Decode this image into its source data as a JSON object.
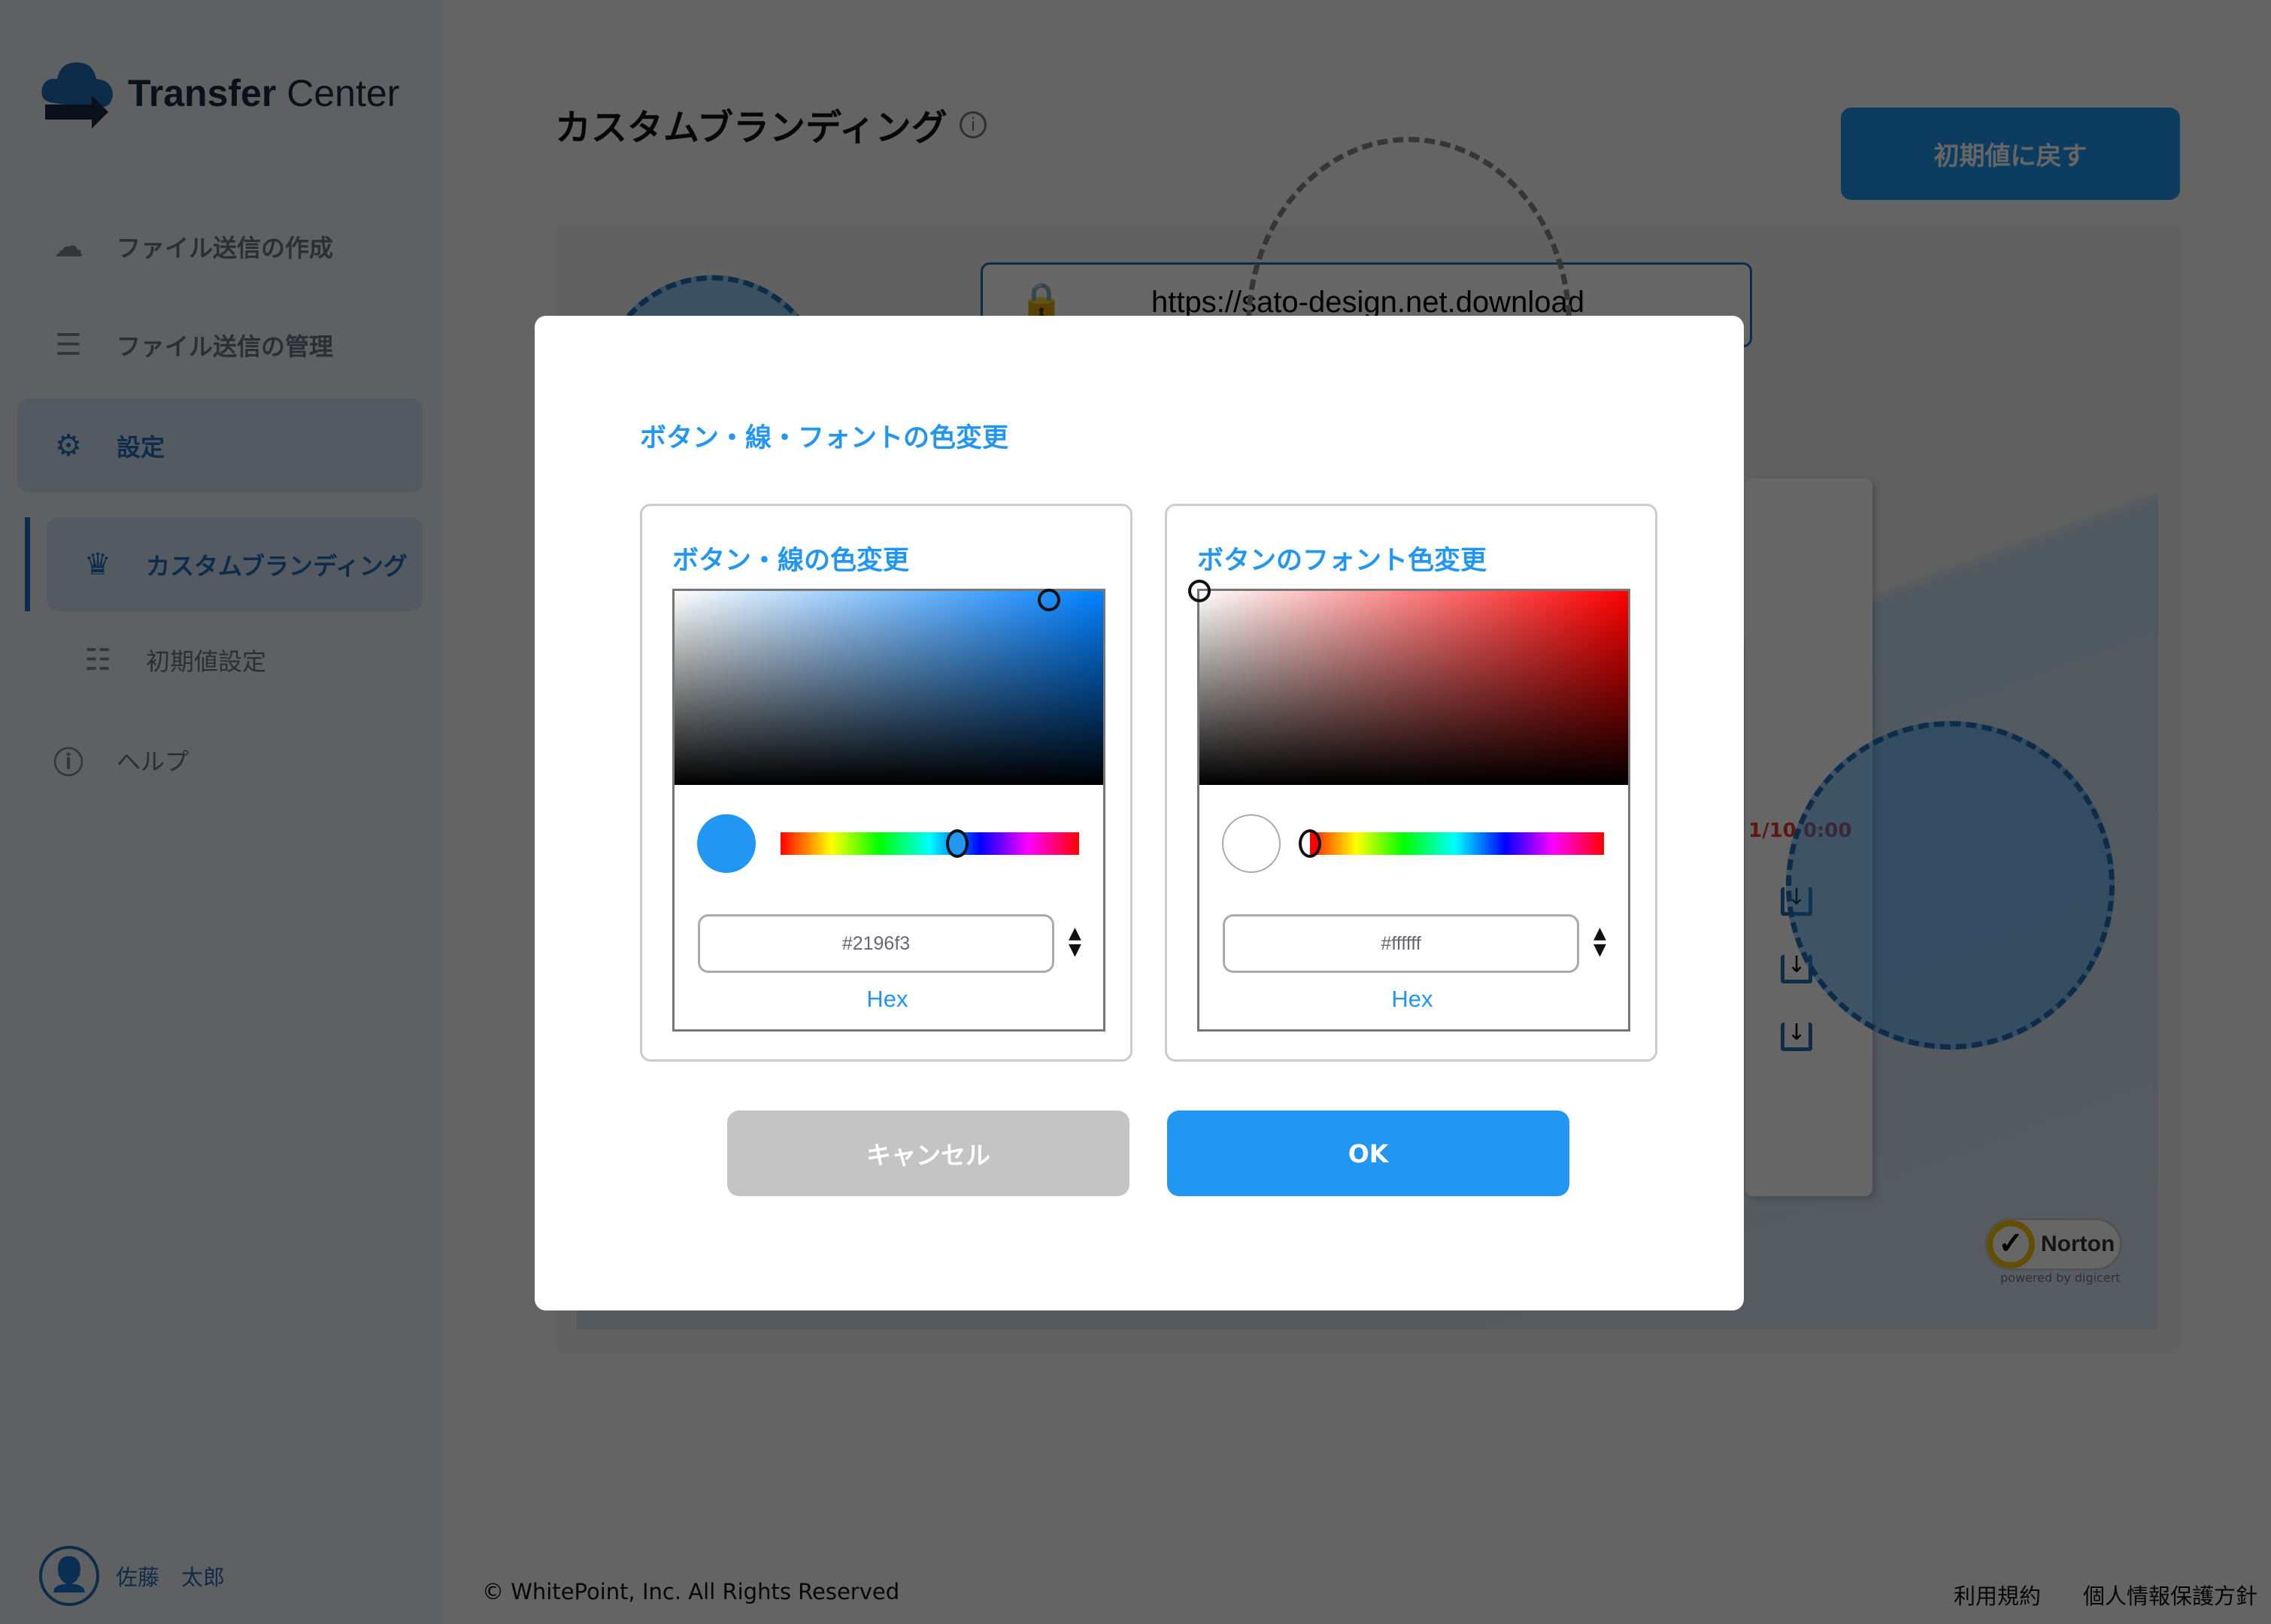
{
  "app": {
    "logo_text_bold": "Transfer",
    "logo_text_light": " Center"
  },
  "sidebar": {
    "items": [
      {
        "label": "ファイル送信の作成",
        "icon": "cloud-upload-icon"
      },
      {
        "label": "ファイル送信の管理",
        "icon": "list-icon"
      },
      {
        "label": "設定",
        "icon": "gear-icon",
        "active": true
      },
      {
        "label": "カスタムブランディング",
        "icon": "crown-icon",
        "active": true
      },
      {
        "label": "初期値設定",
        "icon": "sliders-icon"
      },
      {
        "label": "ヘルプ",
        "icon": "help-icon"
      }
    ],
    "user": "佐藤　太郎"
  },
  "page": {
    "title": "カスタムブランディング",
    "reset_label": "初期値に戻す"
  },
  "preview": {
    "url": "https://sato-design.net.download",
    "date": "1/10 0:00",
    "norton": "Norton",
    "norton_sub": "powered by digicert"
  },
  "footer": {
    "copyright": "© WhitePoint, Inc. All Rights Reserved",
    "terms": "利用規約",
    "privacy": "個人情報保護方針"
  },
  "modal": {
    "heading": "ボタン・線・フォントの色変更",
    "pickers": [
      {
        "title": "ボタン・線の色変更",
        "hex": "#2196f3",
        "format": "Hex",
        "hue_color": "#0080ff",
        "hue_position": 0.57
      },
      {
        "title": "ボタンのフォント色変更",
        "hex": "#ffffff",
        "format": "Hex",
        "hue_color": "#ff0000",
        "hue_position": 0.0
      }
    ],
    "cancel_label": "キャンセル",
    "ok_label": "OK"
  },
  "colors": {
    "accent": "#2196f3",
    "cancel": "#c4c4c4"
  }
}
